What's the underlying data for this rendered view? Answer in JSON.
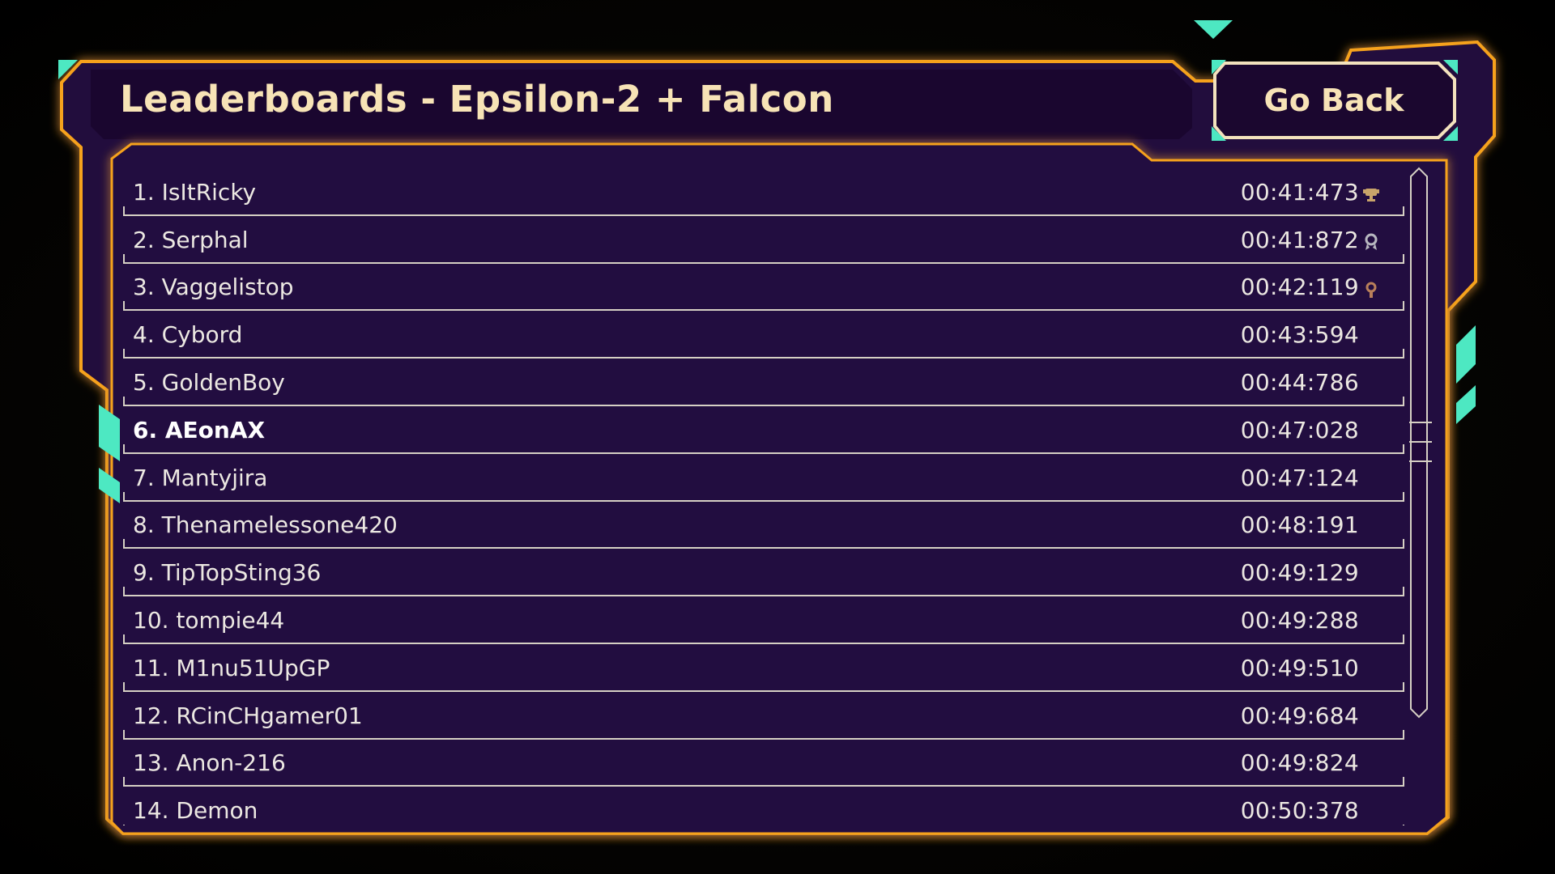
{
  "title": "Leaderboards - Epsilon-2 + Falcon",
  "go_back_label": "Go Back",
  "colors": {
    "frame_orange": "#f6a21d",
    "panel_purple": "#22093d",
    "accent_teal": "#4de8c2",
    "text_cream": "#f7e3b6",
    "row_text": "#ece8e2"
  },
  "highlighted_rank": 6,
  "entries": [
    {
      "label": "1. IsItRicky",
      "time": "00:41:473",
      "medal": "trophy-icon"
    },
    {
      "label": "2. Serphal",
      "time": "00:41:872",
      "medal": "silver-medal-icon"
    },
    {
      "label": "3. Vaggelistop",
      "time": "00:42:119",
      "medal": "bronze-medal-icon"
    },
    {
      "label": "4. Cybord",
      "time": "00:43:594",
      "medal": ""
    },
    {
      "label": "5. GoldenBoy",
      "time": "00:44:786",
      "medal": ""
    },
    {
      "label": "6. AEonAX",
      "time": "00:47:028",
      "medal": ""
    },
    {
      "label": "7. Mantyjira",
      "time": "00:47:124",
      "medal": ""
    },
    {
      "label": "8. Thenamelessone420",
      "time": "00:48:191",
      "medal": ""
    },
    {
      "label": "9. TipTopSting36",
      "time": "00:49:129",
      "medal": ""
    },
    {
      "label": "10. tompie44",
      "time": "00:49:288",
      "medal": ""
    },
    {
      "label": "11. M1nu51UpGP",
      "time": "00:49:510",
      "medal": ""
    },
    {
      "label": "12. RCinCHgamer01",
      "time": "00:49:684",
      "medal": ""
    },
    {
      "label": "13. Anon-216",
      "time": "00:49:824",
      "medal": ""
    },
    {
      "label": "14. Demon",
      "time": "00:50:378",
      "medal": ""
    }
  ]
}
